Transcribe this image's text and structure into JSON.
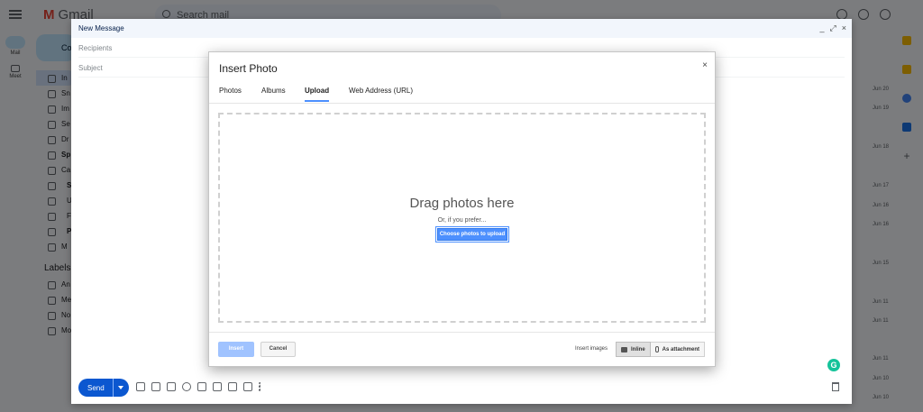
{
  "gmail": {
    "logo_text": "Gmail",
    "search_placeholder": "Search mail",
    "rail": [
      {
        "label": "Mail"
      },
      {
        "label": "Meet"
      }
    ],
    "sidebar": {
      "compose_label": "Co",
      "items": [
        {
          "label": "In"
        },
        {
          "label": "Sn"
        },
        {
          "label": "Im"
        },
        {
          "label": "Se"
        },
        {
          "label": "Dr"
        },
        {
          "label": "Sp"
        },
        {
          "label": "Ca"
        },
        {
          "label": "S"
        },
        {
          "label": "U"
        },
        {
          "label": "F"
        },
        {
          "label": "P"
        },
        {
          "label": "M"
        }
      ],
      "labels_heading": "Labels",
      "label_items": [
        {
          "label": "An"
        },
        {
          "label": "Me"
        },
        {
          "label": "No"
        },
        {
          "label": "Mo"
        }
      ]
    },
    "dates": [
      "Jun 20",
      "Jun 19",
      "Jun 18",
      "Jun 17",
      "Jun 16",
      "Jun 16",
      "Jun 15",
      "Jun 11",
      "Jun 11",
      "Jun 11",
      "Jun 10",
      "Jun 10"
    ]
  },
  "compose": {
    "title": "New Message",
    "recipients_placeholder": "Recipients",
    "subject_placeholder": "Subject",
    "send_label": "Send"
  },
  "dialog": {
    "title": "Insert Photo",
    "close_label": "×",
    "tabs": [
      {
        "label": "Photos"
      },
      {
        "label": "Albums"
      },
      {
        "label": "Upload"
      },
      {
        "label": "Web Address (URL)"
      }
    ],
    "active_tab": "Upload",
    "drop_title": "Drag photos here",
    "drop_subtitle": "Or, if you prefer...",
    "choose_button": "Choose photos to upload",
    "insert_button": "Insert",
    "cancel_button": "Cancel",
    "insert_images_label": "Insert images",
    "inline_option": "Inline",
    "attachment_option": "As attachment",
    "selected_option": "Inline"
  },
  "colors": {
    "accent": "#4d90fe",
    "send": "#0b57d0",
    "insert_disabled": "#a0c3ff"
  }
}
